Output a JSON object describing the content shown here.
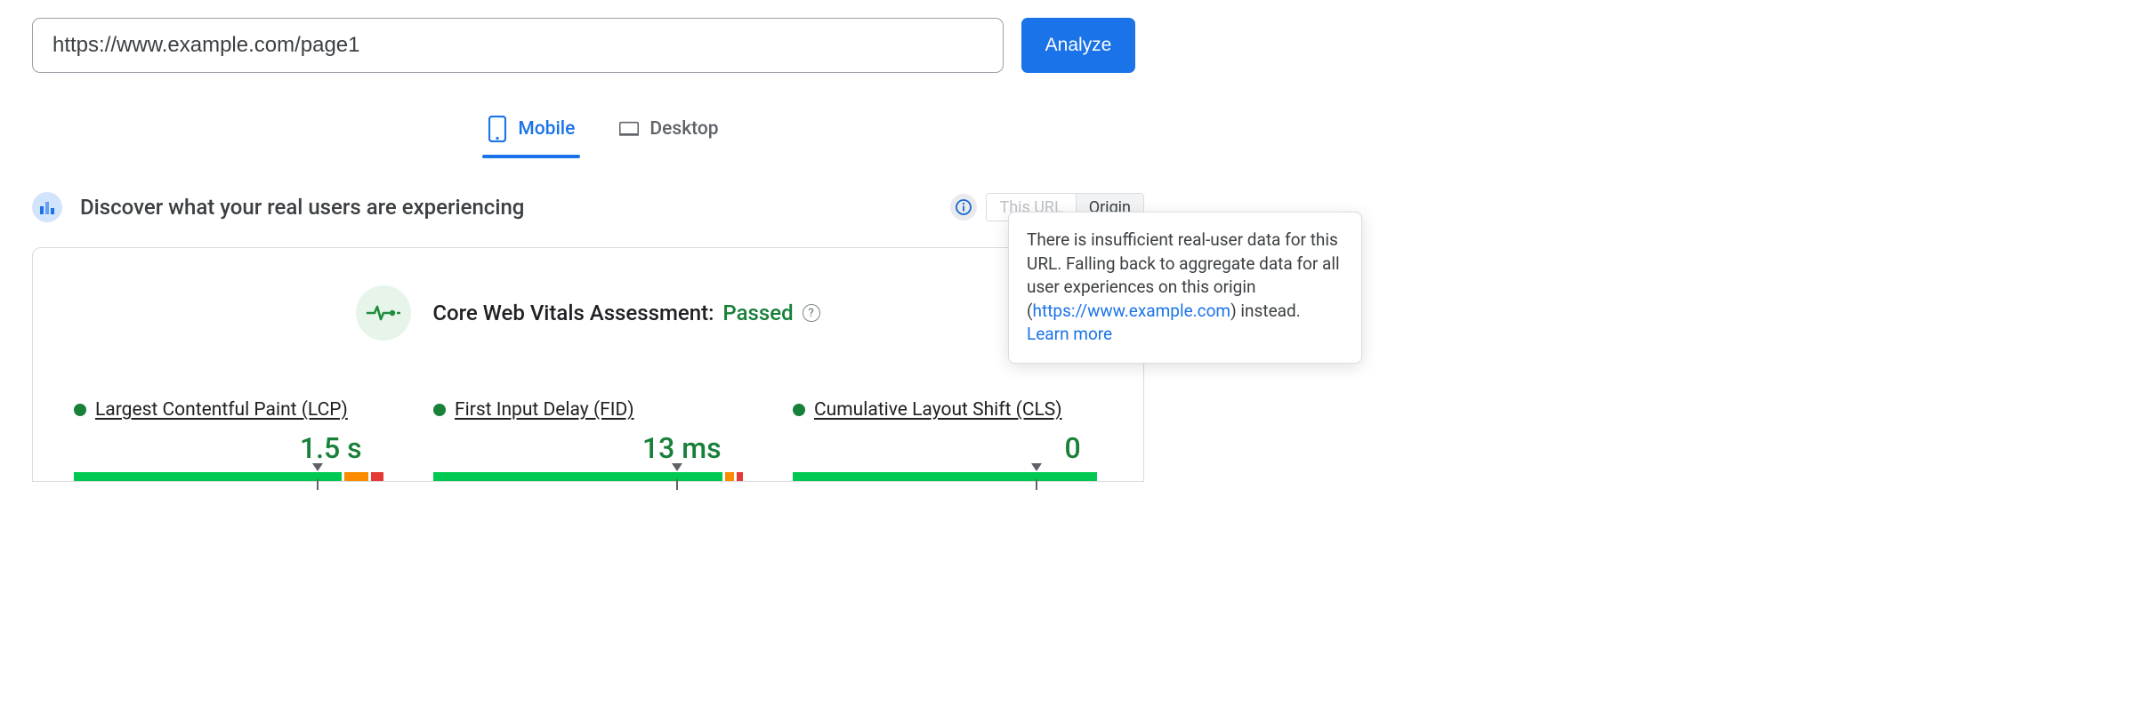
{
  "url_input": {
    "value": "https://www.example.com/page1"
  },
  "analyze": {
    "label": "Analyze"
  },
  "tabs": {
    "mobile": "Mobile",
    "desktop": "Desktop"
  },
  "section": {
    "title": "Discover what your real users are experiencing"
  },
  "toggle": {
    "this_url": "This URL",
    "origin": "Origin"
  },
  "assessment": {
    "label": "Core Web Vitals Assessment: ",
    "status": "Passed"
  },
  "metrics": {
    "lcp": {
      "name": "Largest Contentful Paint (LCP)",
      "value": "1.5 s",
      "dist": {
        "green": 88,
        "orange": 8,
        "red": 4
      },
      "pointer_pct": 77
    },
    "fid": {
      "name": "First Input Delay (FID)",
      "value": "13 ms",
      "dist": {
        "green": 95,
        "orange": 3,
        "red": 2
      },
      "pointer_pct": 77
    },
    "cls": {
      "name": "Cumulative Layout Shift (CLS)",
      "value": "0",
      "dist": {
        "green": 100,
        "orange": 0,
        "red": 0
      },
      "pointer_pct": 77
    }
  },
  "popover": {
    "pre": "There is insufficient real-user data for this URL. Falling back to aggregate data for all user experiences on this origin (",
    "origin_link": "https://www.example.com",
    "post": ") instead. ",
    "learn_more": "Learn more"
  }
}
